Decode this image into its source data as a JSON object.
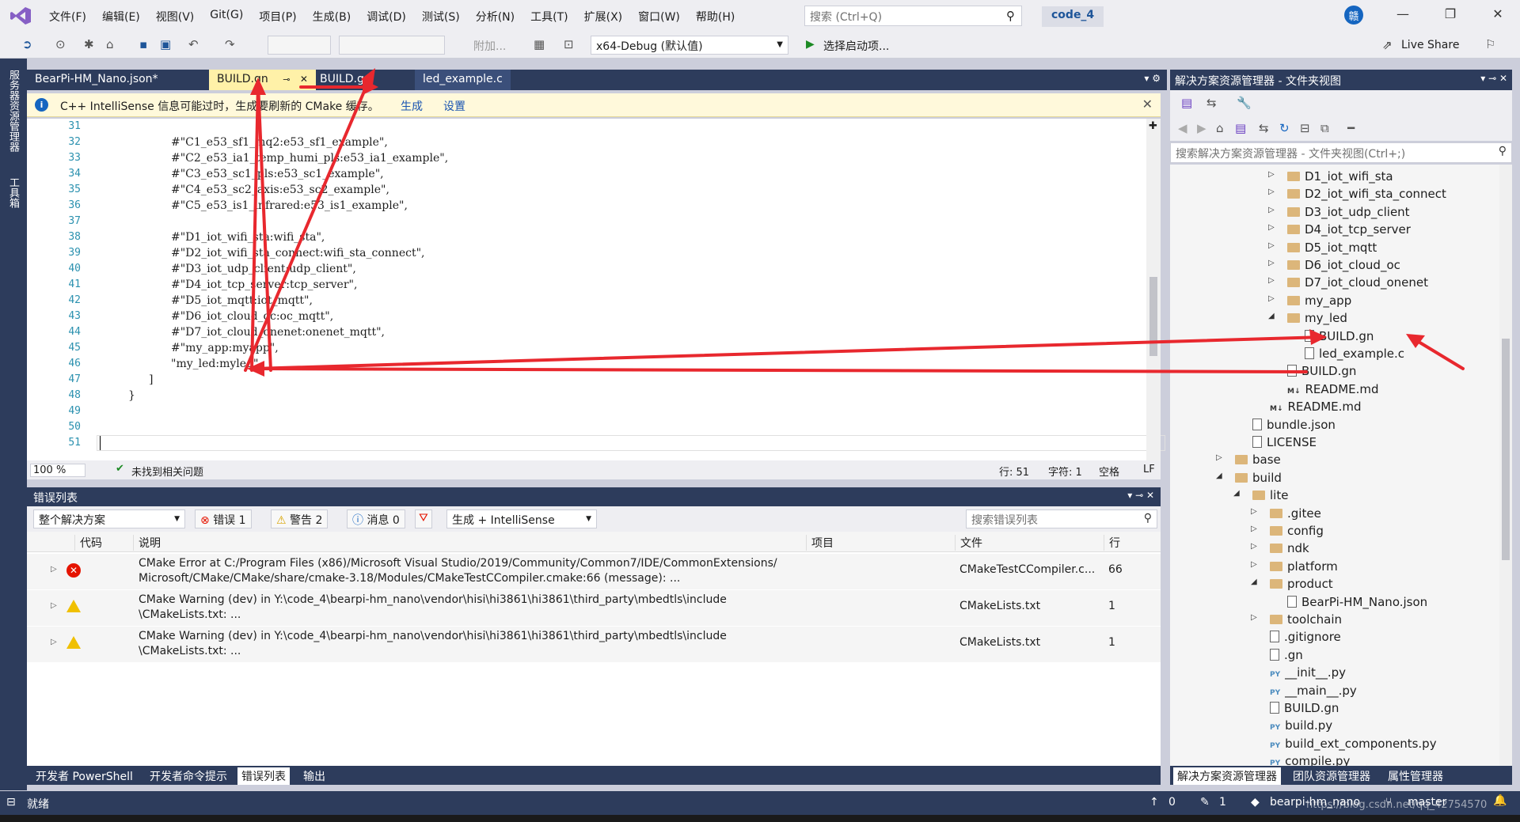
{
  "menu": {
    "items": [
      "文件(F)",
      "编辑(E)",
      "视图(V)",
      "Git(G)",
      "项目(P)",
      "生成(B)",
      "调试(D)",
      "测试(S)",
      "分析(N)",
      "工具(T)",
      "扩展(X)",
      "窗口(W)",
      "帮助(H)"
    ],
    "search_placeholder": "搜索 (Ctrl+Q)",
    "project_name": "code_4",
    "avatar_text": "赣"
  },
  "toolbar": {
    "attach_label": "附加...",
    "config": "x64-Debug (默认值)",
    "run_label": "选择启动项...",
    "live_share": "Live Share"
  },
  "left_sidebar": {
    "tab1": "服务器资源管理器",
    "tab2": "工具箱"
  },
  "editor": {
    "tabs": [
      "BearPi-HM_Nano.json*",
      "BUILD.gn",
      "BUILD.gn",
      "led_example.c"
    ],
    "infobar": {
      "text": "C++ IntelliSense 信息可能过时，生成要刷新的 CMake 缓存。",
      "link1": "生成",
      "link2": "设置"
    },
    "lines": [
      {
        "n": "31",
        "t": ""
      },
      {
        "n": "32",
        "t": "#\"C1_e53_sf1_mq2:e53_sf1_example\","
      },
      {
        "n": "33",
        "t": "#\"C2_e53_ia1_temp_humi_pls:e53_ia1_example\","
      },
      {
        "n": "34",
        "t": "#\"C3_e53_sc1_pls:e53_sc1_example\","
      },
      {
        "n": "35",
        "t": "#\"C4_e53_sc2_axis:e53_sc2_example\","
      },
      {
        "n": "36",
        "t": "#\"C5_e53_is1_infrared:e53_is1_example\","
      },
      {
        "n": "37",
        "t": ""
      },
      {
        "n": "38",
        "t": "#\"D1_iot_wifi_sta:wifi_sta\","
      },
      {
        "n": "39",
        "t": "#\"D2_iot_wifi_sta_connect:wifi_sta_connect\","
      },
      {
        "n": "40",
        "t": "#\"D3_iot_udp_client:udp_client\","
      },
      {
        "n": "41",
        "t": "#\"D4_iot_tcp_server:tcp_server\","
      },
      {
        "n": "42",
        "t": "#\"D5_iot_mqtt:iot_mqtt\","
      },
      {
        "n": "43",
        "t": "#\"D6_iot_cloud_oc:oc_mqtt\","
      },
      {
        "n": "44",
        "t": "#\"D7_iot_cloud_onenet:onenet_mqtt\","
      },
      {
        "n": "45",
        "t": "#\"my_app:myapp\","
      },
      {
        "n": "46",
        "t": "\"my_led:myled\""
      },
      {
        "n": "47",
        "t": "]"
      },
      {
        "n": "48",
        "t": "}"
      },
      {
        "n": "49",
        "t": ""
      },
      {
        "n": "50",
        "t": ""
      },
      {
        "n": "51",
        "t": ""
      }
    ],
    "status": {
      "zoom": "100 %",
      "issues": "未找到相关问题",
      "row": "行: 51",
      "col": "字符: 1",
      "ws": "空格",
      "eol": "LF"
    }
  },
  "error_list": {
    "title": "错误列表",
    "scope": "整个解决方案",
    "errors_btn": "错误 1",
    "warnings_btn": "警告 2",
    "messages_btn": "消息 0",
    "build_filter": "生成 + IntelliSense",
    "search_placeholder": "搜索错误列表",
    "columns": [
      "代码",
      "说明",
      "项目",
      "文件",
      "行"
    ],
    "rows": [
      {
        "type": "error",
        "desc1": "CMake Error at C:/Program Files (x86)/Microsoft Visual Studio/2019/Community/Common7/IDE/CommonExtensions/",
        "desc2": "Microsoft/CMake/CMake/share/cmake-3.18/Modules/CMakeTestCCompiler.cmake:66 (message): ...",
        "file": "CMakeTestCCompiler.c...",
        "line": "66"
      },
      {
        "type": "warning",
        "desc1": "CMake Warning (dev) in Y:\\code_4\\bearpi-hm_nano\\vendor\\hisi\\hi3861\\hi3861\\third_party\\mbedtls\\include",
        "desc2": "\\CMakeLists.txt: ...",
        "file": "CMakeLists.txt",
        "line": "1"
      },
      {
        "type": "warning",
        "desc1": "CMake Warning (dev) in Y:\\code_4\\bearpi-hm_nano\\vendor\\hisi\\hi3861\\hi3861\\third_party\\mbedtls\\include",
        "desc2": "\\CMakeLists.txt: ...",
        "file": "CMakeLists.txt",
        "line": "1"
      }
    ]
  },
  "bottom_tabs": [
    "开发者 PowerShell",
    "开发者命令提示",
    "错误列表",
    "输出"
  ],
  "solution_explorer": {
    "title": "解决方案资源管理器 - 文件夹视图",
    "search_placeholder": "搜索解决方案资源管理器 - 文件夹视图(Ctrl+;)",
    "tree": [
      {
        "label": "D1_iot_wifi_sta",
        "kind": "folder",
        "depth": 3,
        "arrow": "▷"
      },
      {
        "label": "D2_iot_wifi_sta_connect",
        "kind": "folder",
        "depth": 3,
        "arrow": "▷"
      },
      {
        "label": "D3_iot_udp_client",
        "kind": "folder",
        "depth": 3,
        "arrow": "▷"
      },
      {
        "label": "D4_iot_tcp_server",
        "kind": "folder",
        "depth": 3,
        "arrow": "▷"
      },
      {
        "label": "D5_iot_mqtt",
        "kind": "folder",
        "depth": 3,
        "arrow": "▷"
      },
      {
        "label": "D6_iot_cloud_oc",
        "kind": "folder",
        "depth": 3,
        "arrow": "▷"
      },
      {
        "label": "D7_iot_cloud_onenet",
        "kind": "folder",
        "depth": 3,
        "arrow": "▷"
      },
      {
        "label": "my_app",
        "kind": "folder",
        "depth": 3,
        "arrow": "▷"
      },
      {
        "label": "my_led",
        "kind": "folder",
        "depth": 3,
        "arrow": "◢"
      },
      {
        "label": "BUILD.gn",
        "kind": "file",
        "depth": 4,
        "arrow": ""
      },
      {
        "label": "led_example.c",
        "kind": "file",
        "depth": 4,
        "arrow": ""
      },
      {
        "label": "BUILD.gn",
        "kind": "file",
        "depth": 3,
        "arrow": ""
      },
      {
        "label": "README.md",
        "kind": "md",
        "depth": 3,
        "arrow": ""
      },
      {
        "label": "README.md",
        "kind": "md",
        "depth": 2,
        "arrow": ""
      },
      {
        "label": "bundle.json",
        "kind": "file",
        "depth": 1,
        "arrow": ""
      },
      {
        "label": "LICENSE",
        "kind": "file",
        "depth": 1,
        "arrow": ""
      },
      {
        "label": "base",
        "kind": "folder",
        "depth": 0,
        "arrow": "▷"
      },
      {
        "label": "build",
        "kind": "folder",
        "depth": 0,
        "arrow": "◢"
      },
      {
        "label": "lite",
        "kind": "folder",
        "depth": 1,
        "arrow": "◢"
      },
      {
        "label": ".gitee",
        "kind": "folder",
        "depth": 2,
        "arrow": "▷"
      },
      {
        "label": "config",
        "kind": "folder",
        "depth": 2,
        "arrow": "▷"
      },
      {
        "label": "ndk",
        "kind": "folder",
        "depth": 2,
        "arrow": "▷"
      },
      {
        "label": "platform",
        "kind": "folder",
        "depth": 2,
        "arrow": "▷"
      },
      {
        "label": "product",
        "kind": "folder",
        "depth": 2,
        "arrow": "◢"
      },
      {
        "label": "BearPi-HM_Nano.json",
        "kind": "file",
        "depth": 3,
        "arrow": ""
      },
      {
        "label": "toolchain",
        "kind": "folder",
        "depth": 2,
        "arrow": "▷"
      },
      {
        "label": ".gitignore",
        "kind": "file",
        "depth": 2,
        "arrow": ""
      },
      {
        "label": ".gn",
        "kind": "file",
        "depth": 2,
        "arrow": ""
      },
      {
        "label": "__init__.py",
        "kind": "py",
        "depth": 2,
        "arrow": ""
      },
      {
        "label": "__main__.py",
        "kind": "py",
        "depth": 2,
        "arrow": ""
      },
      {
        "label": "BUILD.gn",
        "kind": "file",
        "depth": 2,
        "arrow": ""
      },
      {
        "label": "build.py",
        "kind": "py",
        "depth": 2,
        "arrow": ""
      },
      {
        "label": "build_ext_components.py",
        "kind": "py",
        "depth": 2,
        "arrow": ""
      },
      {
        "label": "compile.py",
        "kind": "py",
        "depth": 2,
        "arrow": ""
      }
    ],
    "bottom_tabs": [
      "解决方案资源管理器",
      "团队资源管理器",
      "属性管理器"
    ]
  },
  "statusbar": {
    "ready": "就绪",
    "up": "0",
    "edits": "1",
    "repo": "bearpi-hm_nano",
    "branch": "master",
    "watermark": "https://blog.csdn.net/qq_42754570"
  }
}
